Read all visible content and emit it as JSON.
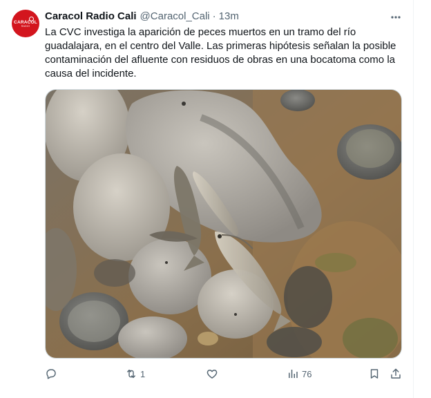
{
  "tweet": {
    "author_name": "Caracol Radio Cali",
    "handle": "@Caracol_Cali",
    "separator": "·",
    "time": "13m",
    "text": "La CVC investiga la aparición de peces muertos en un tramo del río guadalajara, en el centro del Valle. Las primeras hipótesis señalan la posible contaminación del afluente con residuos de obras en una bocatoma como la causa del incidente.",
    "avatar_logo": "CARACOL",
    "avatar_sub": "RADIO"
  },
  "actions": {
    "reply_count": "",
    "retweet_count": "1",
    "like_count": "",
    "views_count": "76"
  },
  "colors": {
    "accent": "#d3151e",
    "muted": "#536471",
    "text": "#0f1419"
  },
  "icons": [
    "more-icon",
    "reply-icon",
    "retweet-icon",
    "like-icon",
    "views-icon",
    "bookmark-icon",
    "share-icon"
  ]
}
